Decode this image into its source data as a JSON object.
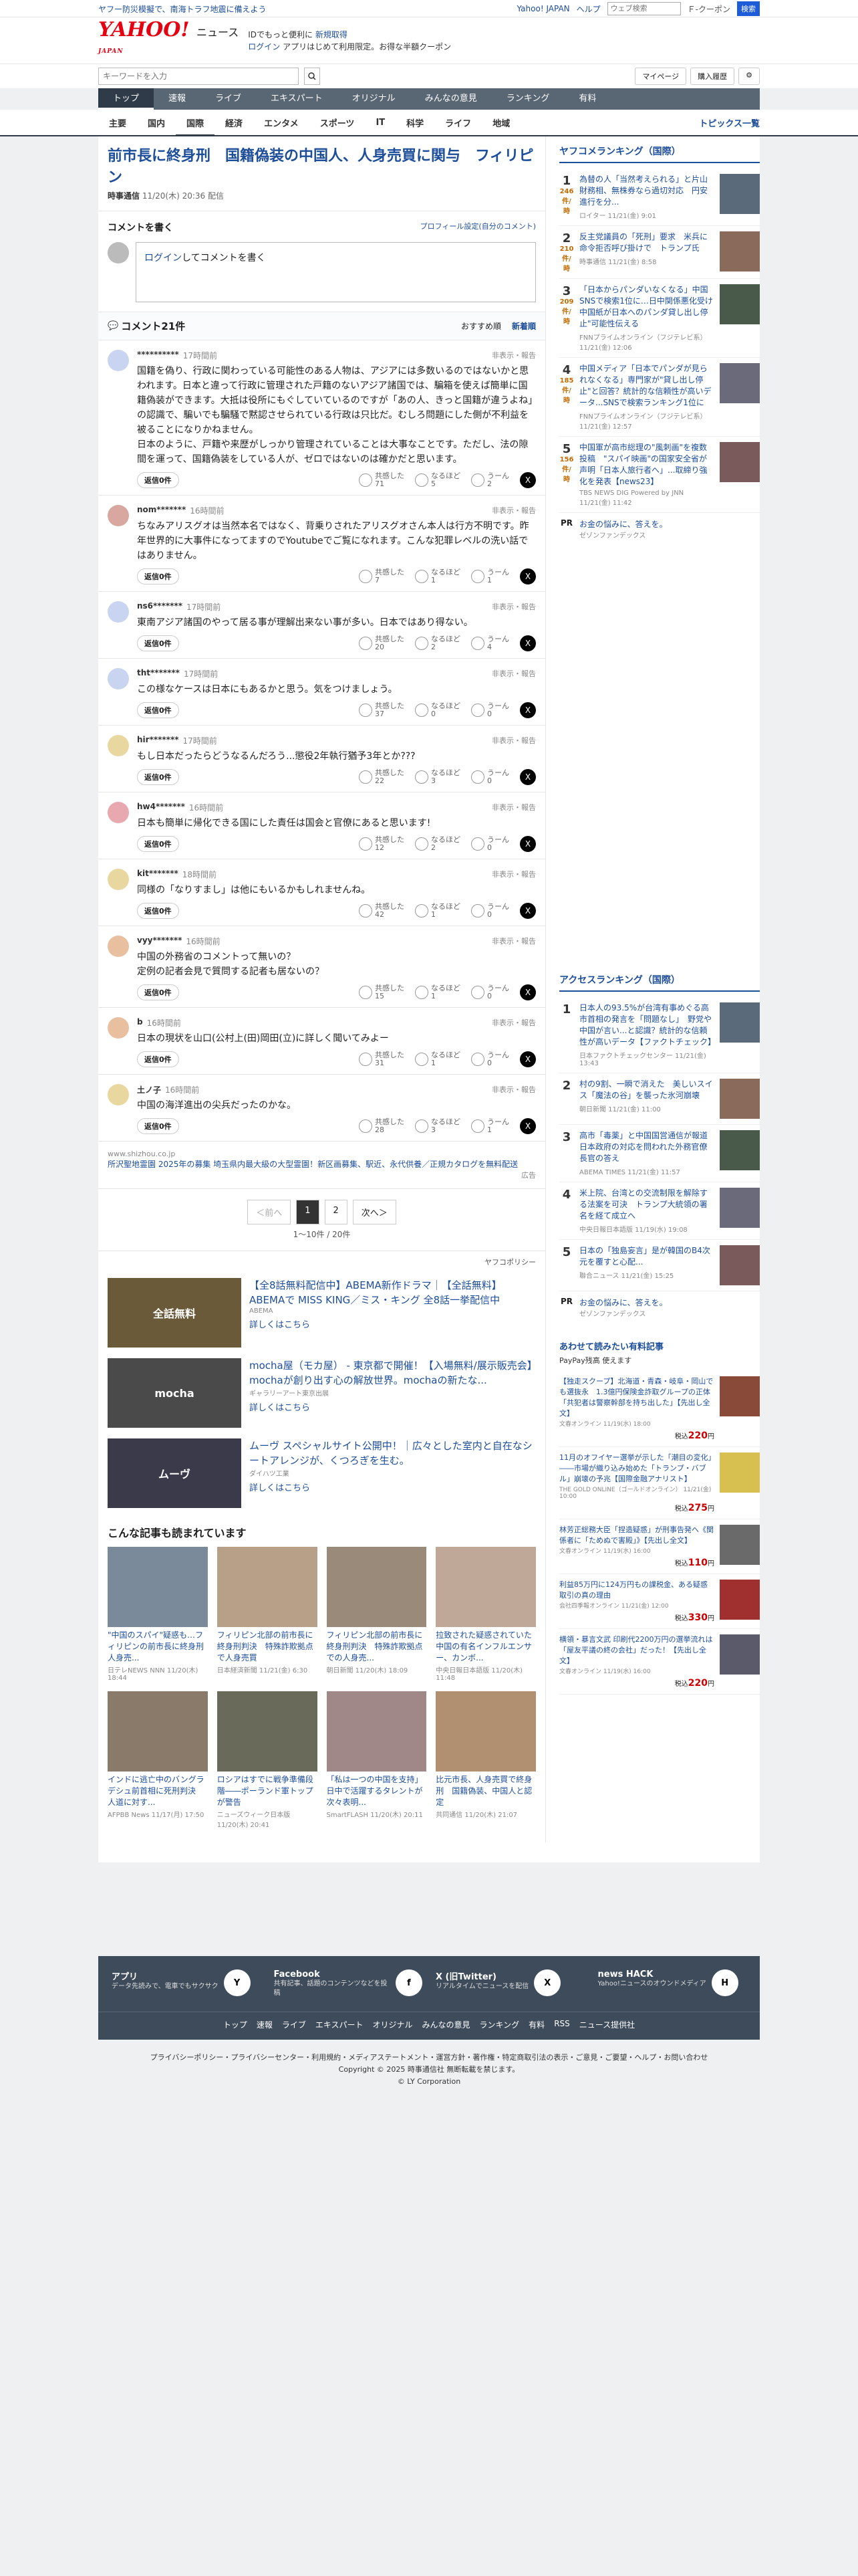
{
  "topstrip": {
    "notice": "ヤフー防災模擬で、南海トラフ地震に備えよう",
    "yjapan": "Yahoo! JAPAN",
    "help": "ヘルプ",
    "search_placeholder": "ウェブ検索",
    "campaign": "Ｆ-クーポン",
    "btn": "検索"
  },
  "brand": {
    "logo": "YAHOO!",
    "logo_sub": "JAPAN",
    "service": "ニュース",
    "promo1": "IDでもっと便利に",
    "promo1b": "新規取得",
    "promo2": "ログイン",
    "promo2b": "アプリはじめて利用限定。お得な半額クーポン"
  },
  "search": {
    "placeholder": "キーワードを入力",
    "my": "マイページ",
    "purchase": "購入履歴"
  },
  "gnav": [
    "トップ",
    "速報",
    "ライブ",
    "エキスパート",
    "オリジナル",
    "みんなの意見",
    "ランキング",
    "有料"
  ],
  "subnav": [
    "主要",
    "国内",
    "国際",
    "経済",
    "エンタメ",
    "スポーツ",
    "IT",
    "科学",
    "ライフ",
    "地域"
  ],
  "subnav_right": "トピックス一覧",
  "article": {
    "title": "前市長に終身刑　国籍偽装の中国人、人身売買に関与　フィリピン",
    "source": "時事通信",
    "date": "11/20(木) 20:36 配信"
  },
  "comment_write": {
    "heading": "コメントを書く",
    "profile_link": "プロフィール設定(自分のコメント)",
    "login": "ログイン",
    "prompt": "してコメントを書く"
  },
  "comments_head": {
    "title": "コメント21件",
    "sort_recommend": "おすすめ順",
    "sort_new": "新着順"
  },
  "comment_labels": {
    "reply": "返信0件",
    "report": "非表示・報告",
    "agree": "共感した",
    "think": "なるほど",
    "hmm": "うーん"
  },
  "comments": [
    {
      "user": "**********",
      "time": "17時間前",
      "text": "国籍を偽り、行政に関わっている可能性のある人物は、アジアには多数いるのではないかと思われます。日本と違って行政に管理された戸籍のないアジア諸国では、騙箱を使えば簡単に国籍偽装ができます。大抵は役所にもぐしていているのですが「あの人、きっと国籍が違うよね」の認識で、騙いでも騙騒で黙認させられている行政は只比だ。むしろ問題にした側が不利益を被ることになりかねません。\n日本のように、戸籍や来歴がしっかり管理されていることは大事なことです。ただし、法の隙間を運って、国籍偽装をしている人が、ゼロではないのは確かだと思います。",
      "a": "71",
      "b": "5",
      "c": "2"
    },
    {
      "user": "nom*******",
      "time": "16時間前",
      "text": "ちなみアリスグオは当然本名ではなく、背乗りされたアリスグオさん本人は行方不明です。昨年世界的に大事件になってますのでYoutubeでご覧になれます。こんな犯罪レベルの洗い話ではありません。",
      "a": "7",
      "b": "1",
      "c": "1"
    },
    {
      "user": "ns6*******",
      "time": "17時間前",
      "text": "東南アジア諸国のやって居る事が理解出来ない事が多い。日本ではあり得ない。",
      "a": "20",
      "b": "2",
      "c": "4"
    },
    {
      "user": "tht*******",
      "time": "17時間前",
      "text": "この様なケースは日本にもあるかと思う。気をつけましょう。",
      "a": "37",
      "b": "0",
      "c": "0"
    },
    {
      "user": "hir*******",
      "time": "17時間前",
      "text": "もし日本だったらどうなるんだろう...懲役2年執行猶予3年とか???",
      "a": "22",
      "b": "3",
      "c": "0"
    },
    {
      "user": "hw4*******",
      "time": "16時間前",
      "text": "日本も簡単に帰化できる国にした責任は国会と官僚にあると思います!",
      "a": "12",
      "b": "2",
      "c": "0"
    },
    {
      "user": "kit*******",
      "time": "18時間前",
      "text": "同様の「なりすまし」は他にもいるかもしれませんね。",
      "a": "42",
      "b": "1",
      "c": "0"
    },
    {
      "user": "vyy*******",
      "time": "16時間前",
      "text": "中国の外務省のコメントって無いの？\n定例の記者会見で質問する記者も居ないの？",
      "a": "15",
      "b": "1",
      "c": "0"
    },
    {
      "user": "b",
      "time": "16時間前",
      "text": "日本の現状を山口(公村上(田)岡田(立)に詳しく聞いてみよー",
      "a": "31",
      "b": "1",
      "c": "0"
    },
    {
      "user": "土ノ子",
      "time": "16時間前",
      "text": "中国の海洋進出の尖兵だったのかな。",
      "a": "28",
      "b": "3",
      "c": "1"
    }
  ],
  "comment_ad": {
    "domain": "www.shizhou.co.jp",
    "text": "所沢聖地霊園 2025年の募集 埼玉県内最大級の大型霊園！新区画募集、駅近、永代供養／正規カタログを無料配送",
    "ad_label": "広告"
  },
  "pager": {
    "prev": "＜前へ",
    "p1": "1",
    "p2": "2",
    "next": "次へ＞",
    "count": "1〜10件 / 20件"
  },
  "ad_policy": "ヤフコポリシー",
  "ads": [
    {
      "img": "全話無料",
      "title": "【全8話無料配信中】ABEMA新作ドラマ｜【全話無料】ABEMAで MISS KING／ミス・キング 全8話一挙配信中",
      "sponsor": "ABEMA",
      "more": "詳しくはこちら"
    },
    {
      "img": "mocha",
      "title": "mocha屋（モカ屋） - 東京都で開催！【入場無料/展示販売会】mochaが創り出す心の解放世界。mochaの新たな...",
      "sponsor": "ギャラリーアート東京出展",
      "more": "詳しくはこちら"
    },
    {
      "img": "ムーヴ",
      "title": "ムーヴ スペシャルサイト公開中！｜広々とした室内と自在なシートアレンジが、くつろぎを生む。",
      "sponsor": "ダイハツ工業",
      "more": "詳しくはこちら"
    }
  ],
  "related": {
    "heading": "こんな記事も読まれています",
    "items": [
      {
        "t": "\"中国のスパイ\"疑惑も…フィリピンの前市長に終身刑　人身売...",
        "s": "日テレNEWS NNN 11/20(木) 18:44"
      },
      {
        "t": "フィリピン北部の前市長に終身刑判決　特殊詐欺拠点で人身売買",
        "s": "日本経済新聞 11/21(金) 6:30"
      },
      {
        "t": "フィリピン北部の前市長に終身刑判決　特殊詐欺拠点での人身売...",
        "s": "朝日新聞 11/20(木) 18:09"
      },
      {
        "t": "拉致された疑惑されていた中国の有名インフルエンサー、カンボ...",
        "s": "中央日報日本語版 11/20(木) 11:48"
      },
      {
        "t": "インドに逃亡中のバングラデシュ前首相に死刑判決　人道に対す...",
        "s": "AFPBB News 11/17(月) 17:50"
      },
      {
        "t": "ロシアはすでに戦争準備段階――ポーランド軍トップが警告",
        "s": "ニューズウィーク日本版 11/20(木) 20:41"
      },
      {
        "t": "「私は一つの中国を支持」日中で活躍するタレントが次々表明...",
        "s": "SmartFLASH 11/20(木) 20:11"
      },
      {
        "t": "比元市長、人身売買で終身刑　国籍偽装、中国人と認定",
        "s": "共同通信 11/20(木) 21:07"
      }
    ]
  },
  "ranking": {
    "heading": "ヤフコメランキング（国際）",
    "items": [
      {
        "n": "1",
        "c": "246",
        "u": "件/時",
        "t": "為替の人「当然考えられる」と片山財務相、無株券なら過切対応　円安進行を分...",
        "s": "ロイター 11/21(金) 9:01"
      },
      {
        "n": "2",
        "c": "210",
        "u": "件/時",
        "t": "反主党議員の「死刑」要求　米兵に命令拒否呼び掛けで　トランプ氏",
        "s": "時事通信 11/21(金) 8:58"
      },
      {
        "n": "3",
        "c": "209",
        "u": "件/時",
        "t": "「日本からパンダいなくなる」中国SNSで検索1位に…日中関係悪化受け中国紙が日本へのパンダ貸し出し停止\"可能性伝える",
        "s": "FNNプライムオンライン（フジテレビ系） 11/21(金) 12:06"
      },
      {
        "n": "4",
        "c": "185",
        "u": "件/時",
        "t": "中国メディア「日本でパンダが見られなくなる」専門家が\"貸し出し停止\"と回答？統計的な信頼性が高いデータ...SNSで検索ランキング1位に",
        "s": "FNNプライムオンライン（フジテレビ系） 11/21(金) 12:57"
      },
      {
        "n": "5",
        "c": "156",
        "u": "件/時",
        "t": "中国軍が高市総理の\"風刺画\"を複数投稿　\"スパイ映画\"の国家安全省が声明「日本人旅行者へ」...取締り強化を発表【news23】",
        "s": "TBS NEWS DIG Powered by JNN 11/21(金) 11:42"
      }
    ],
    "pr_t": "お金の悩みに、答えを。",
    "pr_s": "ゼゾンファンデックス",
    "ad": "広告"
  },
  "access": {
    "heading": "アクセスランキング（国際）",
    "items": [
      {
        "n": "1",
        "t": "日本人の93.5%が台湾有事めぐる高市首相の発言を「問題なし」　野党や中国が言い...と認識？統計的な信頼性が高いデータ【ファクトチェック】",
        "s": "日本ファクトチェックセンター 11/21(金) 13:43"
      },
      {
        "n": "2",
        "t": "村の9割、一瞬で消えた　美しいスイス「魔法の谷」を襲った氷河崩壊",
        "s": "朝日新聞 11/21(金) 11:00"
      },
      {
        "n": "3",
        "t": "高市「毒薬」と中国国営通信が報道 日本政府の対応を問われた外務官僚長官の答え",
        "s": "ABEMA TIMES 11/21(金) 11:57"
      },
      {
        "n": "4",
        "t": "米上院、台湾との交流制限を解除する法案を可決　トランプ大統領の署名を経て成立へ",
        "s": "中央日報日本語版 11/19(水) 19:08"
      },
      {
        "n": "5",
        "t": "日本の「独島妄言」是が韓国のB4次元を覆すと心配...",
        "s": "聯合ニュース 11/21(金) 15:25"
      }
    ],
    "pr_t": "お金の悩みに、答えを。",
    "pr_s": "ゼゾンファンデックス",
    "ad": "広告"
  },
  "shopping": {
    "heading": "あわせて読みたい有料記事",
    "paypay": "PayPay残高 使えます",
    "items": [
      {
        "t": "【独走スクープ】北海道・青森・岐阜・岡山でも選抜永　1.3億円保険金詐取グループの正体「共犯者は警察幹部を持ち出した」【先出し全文】",
        "s": "文春オンライン 11/19(水) 18:00",
        "p": "220"
      },
      {
        "t": "11月のオフイヤー選挙が示した「潮目の変化」――市場が織り込み始めた「トランプ・バブル」崩壊の予兆【国際金融アナリスト】",
        "s": "THE GOLD ONLINE（ゴールドオンライン） 11/21(金) 10:00",
        "p": "275"
      },
      {
        "t": "林芳正総務大臣「捏造疑惑」が刑事告発へ《関係者に「ためぬで害殿」》【先出し全文】",
        "s": "文春オンライン 11/19(水) 16:00",
        "p": "110"
      },
      {
        "t": "利益85万円に124万円もの課税金、ある疑惑取引の真の理由",
        "s": "会社四季報オンライン 11/21(金) 12:00",
        "p": "330"
      },
      {
        "t": "横領・暴言文武 印刷代2200万円の選挙流れは「屋友平議の終の会社」だった！【先出し全文】",
        "s": "文春オンライン 11/19(水) 16:00",
        "p": "220"
      }
    ],
    "tax": "税込"
  },
  "footer": {
    "apps": [
      {
        "t": "アプリ",
        "d": "データ先読みで、電車でもサクサク",
        "ic": "Y"
      },
      {
        "t": "Facebook",
        "d": "共有記事、話題のコンテンツなどを投稿",
        "ic": "f"
      },
      {
        "t": "X (旧Twitter)",
        "d": "リアルタイムでニュースを配信",
        "ic": "X"
      },
      {
        "t": "news HACK",
        "d": "Yahoo!ニュースのオウンドメディア",
        "ic": "H"
      }
    ],
    "links": [
      "トップ",
      "速報",
      "ライブ",
      "エキスパート",
      "オリジナル",
      "みんなの意見",
      "ランキング",
      "有料",
      "RSS",
      "ニュース提供社"
    ]
  },
  "legal": {
    "line1": "プライバシーポリシー・プライバシーセンター・利用規約・メディアステートメント・運営方針・著作権・特定商取引法の表示・ご意見・ご要望・ヘルプ・お問い合わせ",
    "line2": "Copyright © 2025 時事通信社 無断転載を禁じます。",
    "line3": "© LY Corporation"
  },
  "colors": {
    "accent": "#1d4e9a",
    "nav": "#596674",
    "logo": "#e50012"
  }
}
